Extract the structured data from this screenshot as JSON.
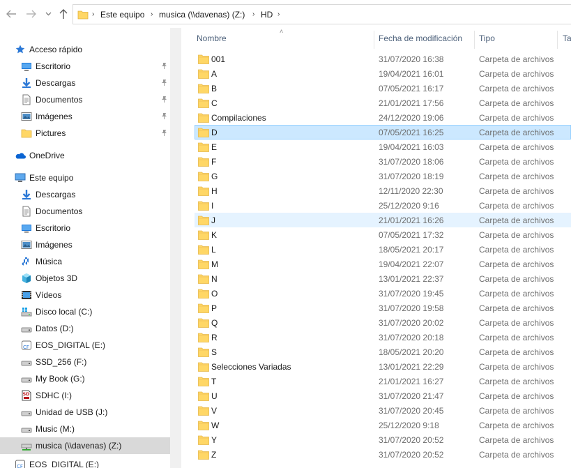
{
  "address": {
    "crumbs": [
      "Este equipo",
      "musica (\\\\davenas) (Z:)",
      "HD"
    ]
  },
  "sidebar": {
    "items": [
      {
        "label": "Acceso rápido",
        "icon": "star-icon",
        "indent": 0,
        "pinned": false
      },
      {
        "label": "Escritorio",
        "icon": "desktop-icon",
        "indent": 1,
        "pinned": true
      },
      {
        "label": "Descargas",
        "icon": "download-icon",
        "indent": 1,
        "pinned": true
      },
      {
        "label": "Documentos",
        "icon": "document-icon",
        "indent": 1,
        "pinned": true
      },
      {
        "label": "Imágenes",
        "icon": "pictures-icon",
        "indent": 1,
        "pinned": true
      },
      {
        "label": "Pictures",
        "icon": "folder-icon",
        "indent": 1,
        "pinned": true
      },
      {
        "label": "OneDrive",
        "icon": "onedrive-icon",
        "indent": 0,
        "pinned": false
      },
      {
        "label": "Este equipo",
        "icon": "computer-icon",
        "indent": 0,
        "pinned": false
      },
      {
        "label": "Descargas",
        "icon": "download-icon",
        "indent": 1,
        "pinned": false
      },
      {
        "label": "Documentos",
        "icon": "document-icon",
        "indent": 1,
        "pinned": false
      },
      {
        "label": "Escritorio",
        "icon": "desktop-icon",
        "indent": 1,
        "pinned": false
      },
      {
        "label": "Imágenes",
        "icon": "pictures-icon",
        "indent": 1,
        "pinned": false
      },
      {
        "label": "Música",
        "icon": "music-icon",
        "indent": 1,
        "pinned": false
      },
      {
        "label": "Objetos 3D",
        "icon": "3d-objects-icon",
        "indent": 1,
        "pinned": false
      },
      {
        "label": "Vídeos",
        "icon": "video-icon",
        "indent": 1,
        "pinned": false
      },
      {
        "label": "Disco local (C:)",
        "icon": "windows-drive-icon",
        "indent": 1,
        "pinned": false
      },
      {
        "label": "Datos (D:)",
        "icon": "drive-icon",
        "indent": 1,
        "pinned": false
      },
      {
        "label": "EOS_DIGITAL (E:)",
        "icon": "removable-drive-icon",
        "indent": 1,
        "pinned": false
      },
      {
        "label": "SSD_256 (F:)",
        "icon": "drive-icon",
        "indent": 1,
        "pinned": false
      },
      {
        "label": "My Book (G:)",
        "icon": "drive-icon",
        "indent": 1,
        "pinned": false
      },
      {
        "label": "SDHC (I:)",
        "icon": "sd-card-icon",
        "indent": 1,
        "pinned": false
      },
      {
        "label": "Unidad de USB (J:)",
        "icon": "drive-icon",
        "indent": 1,
        "pinned": false
      },
      {
        "label": "Music (M:)",
        "icon": "drive-icon",
        "indent": 1,
        "pinned": false
      },
      {
        "label": "musica (\\\\davenas) (Z:)",
        "icon": "network-drive-icon",
        "indent": 1,
        "pinned": false,
        "selected": true
      },
      {
        "label": "EOS_DIGITAL (E:)",
        "icon": "removable-drive-icon",
        "indent": 0,
        "pinned": false
      }
    ]
  },
  "columns": {
    "name": "Nombre",
    "date": "Fecha de modificación",
    "type": "Tipo",
    "size": "Ta"
  },
  "files": [
    {
      "name": "001",
      "date": "31/07/2020 16:38",
      "type": "Carpeta de archivos"
    },
    {
      "name": "A",
      "date": "19/04/2021 16:01",
      "type": "Carpeta de archivos"
    },
    {
      "name": "B",
      "date": "07/05/2021 16:17",
      "type": "Carpeta de archivos"
    },
    {
      "name": "C",
      "date": "21/01/2021 17:56",
      "type": "Carpeta de archivos"
    },
    {
      "name": "Compilaciones",
      "date": "24/12/2020 19:06",
      "type": "Carpeta de archivos"
    },
    {
      "name": "D",
      "date": "07/05/2021 16:25",
      "type": "Carpeta de archivos",
      "state": "selected"
    },
    {
      "name": "E",
      "date": "19/04/2021 16:03",
      "type": "Carpeta de archivos"
    },
    {
      "name": "F",
      "date": "31/07/2020 18:06",
      "type": "Carpeta de archivos"
    },
    {
      "name": "G",
      "date": "31/07/2020 18:19",
      "type": "Carpeta de archivos"
    },
    {
      "name": "H",
      "date": "12/11/2020 22:30",
      "type": "Carpeta de archivos"
    },
    {
      "name": "I",
      "date": "25/12/2020 9:16",
      "type": "Carpeta de archivos"
    },
    {
      "name": "J",
      "date": "21/01/2021 16:26",
      "type": "Carpeta de archivos",
      "state": "hover"
    },
    {
      "name": "K",
      "date": "07/05/2021 17:32",
      "type": "Carpeta de archivos"
    },
    {
      "name": "L",
      "date": "18/05/2021 20:17",
      "type": "Carpeta de archivos"
    },
    {
      "name": "M",
      "date": "19/04/2021 22:07",
      "type": "Carpeta de archivos"
    },
    {
      "name": "N",
      "date": "13/01/2021 22:37",
      "type": "Carpeta de archivos"
    },
    {
      "name": "O",
      "date": "31/07/2020 19:45",
      "type": "Carpeta de archivos"
    },
    {
      "name": "P",
      "date": "31/07/2020 19:58",
      "type": "Carpeta de archivos"
    },
    {
      "name": "Q",
      "date": "31/07/2020 20:02",
      "type": "Carpeta de archivos"
    },
    {
      "name": "R",
      "date": "31/07/2020 20:18",
      "type": "Carpeta de archivos"
    },
    {
      "name": "S",
      "date": "18/05/2021 20:20",
      "type": "Carpeta de archivos"
    },
    {
      "name": "Selecciones Variadas",
      "date": "13/01/2021 22:29",
      "type": "Carpeta de archivos"
    },
    {
      "name": "T",
      "date": "21/01/2021 16:27",
      "type": "Carpeta de archivos"
    },
    {
      "name": "U",
      "date": "31/07/2020 21:47",
      "type": "Carpeta de archivos"
    },
    {
      "name": "V",
      "date": "31/07/2020 20:45",
      "type": "Carpeta de archivos"
    },
    {
      "name": "W",
      "date": "25/12/2020 9:18",
      "type": "Carpeta de archivos"
    },
    {
      "name": "Y",
      "date": "31/07/2020 20:52",
      "type": "Carpeta de archivos"
    },
    {
      "name": "Z",
      "date": "31/07/2020 20:52",
      "type": "Carpeta de archivos"
    }
  ],
  "colors": {
    "folder": "#ffd766",
    "selected_bg": "#cce8ff",
    "hover_bg": "#e5f3ff",
    "header_text": "#4c607a"
  }
}
